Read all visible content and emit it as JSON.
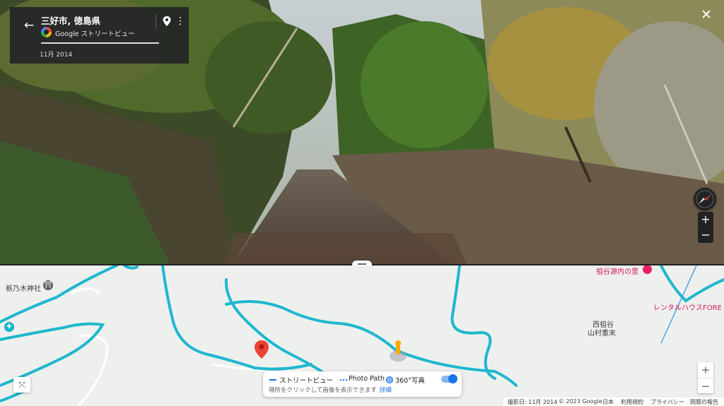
{
  "header": {
    "location_title": "三好市, 徳島県",
    "service_label": "Google ストリートビュー",
    "capture_date": "11月 2014",
    "icons": {
      "back": "arrow-left-icon",
      "pin": "map-pin-icon",
      "more": "more-vert-icon",
      "close": "close-icon"
    }
  },
  "viewer": {
    "compass_icon": "compass-icon",
    "zoom_in_label": "+",
    "zoom_out_label": "−"
  },
  "map": {
    "labels": {
      "shrine": "栃乃木神社",
      "west_iya_1": "西祖谷",
      "west_iya_2": "山村重末",
      "iya_genpei": "祖谷源内の里",
      "rental": "レンタルハウスFORE"
    },
    "zoom_in_label": "+",
    "zoom_out_label": "−",
    "colors": {
      "coverage": "#1fb7cf",
      "pin": "#ea4335",
      "pegman": "#f9ab00",
      "pink": "#e91e63"
    }
  },
  "legend": {
    "street_view": "ストリートビュー",
    "photo_path": "Photo Path",
    "photo_360": "360°写真",
    "hint": "場所をクリックして画像を表示できます",
    "more_link": "詳細"
  },
  "footer": {
    "capture": "撮影日: 11月 2014",
    "copyright": "© 2023 Google",
    "region": "日本",
    "terms": "利用規約",
    "privacy": "プライバシー",
    "report": "問題の報告"
  }
}
